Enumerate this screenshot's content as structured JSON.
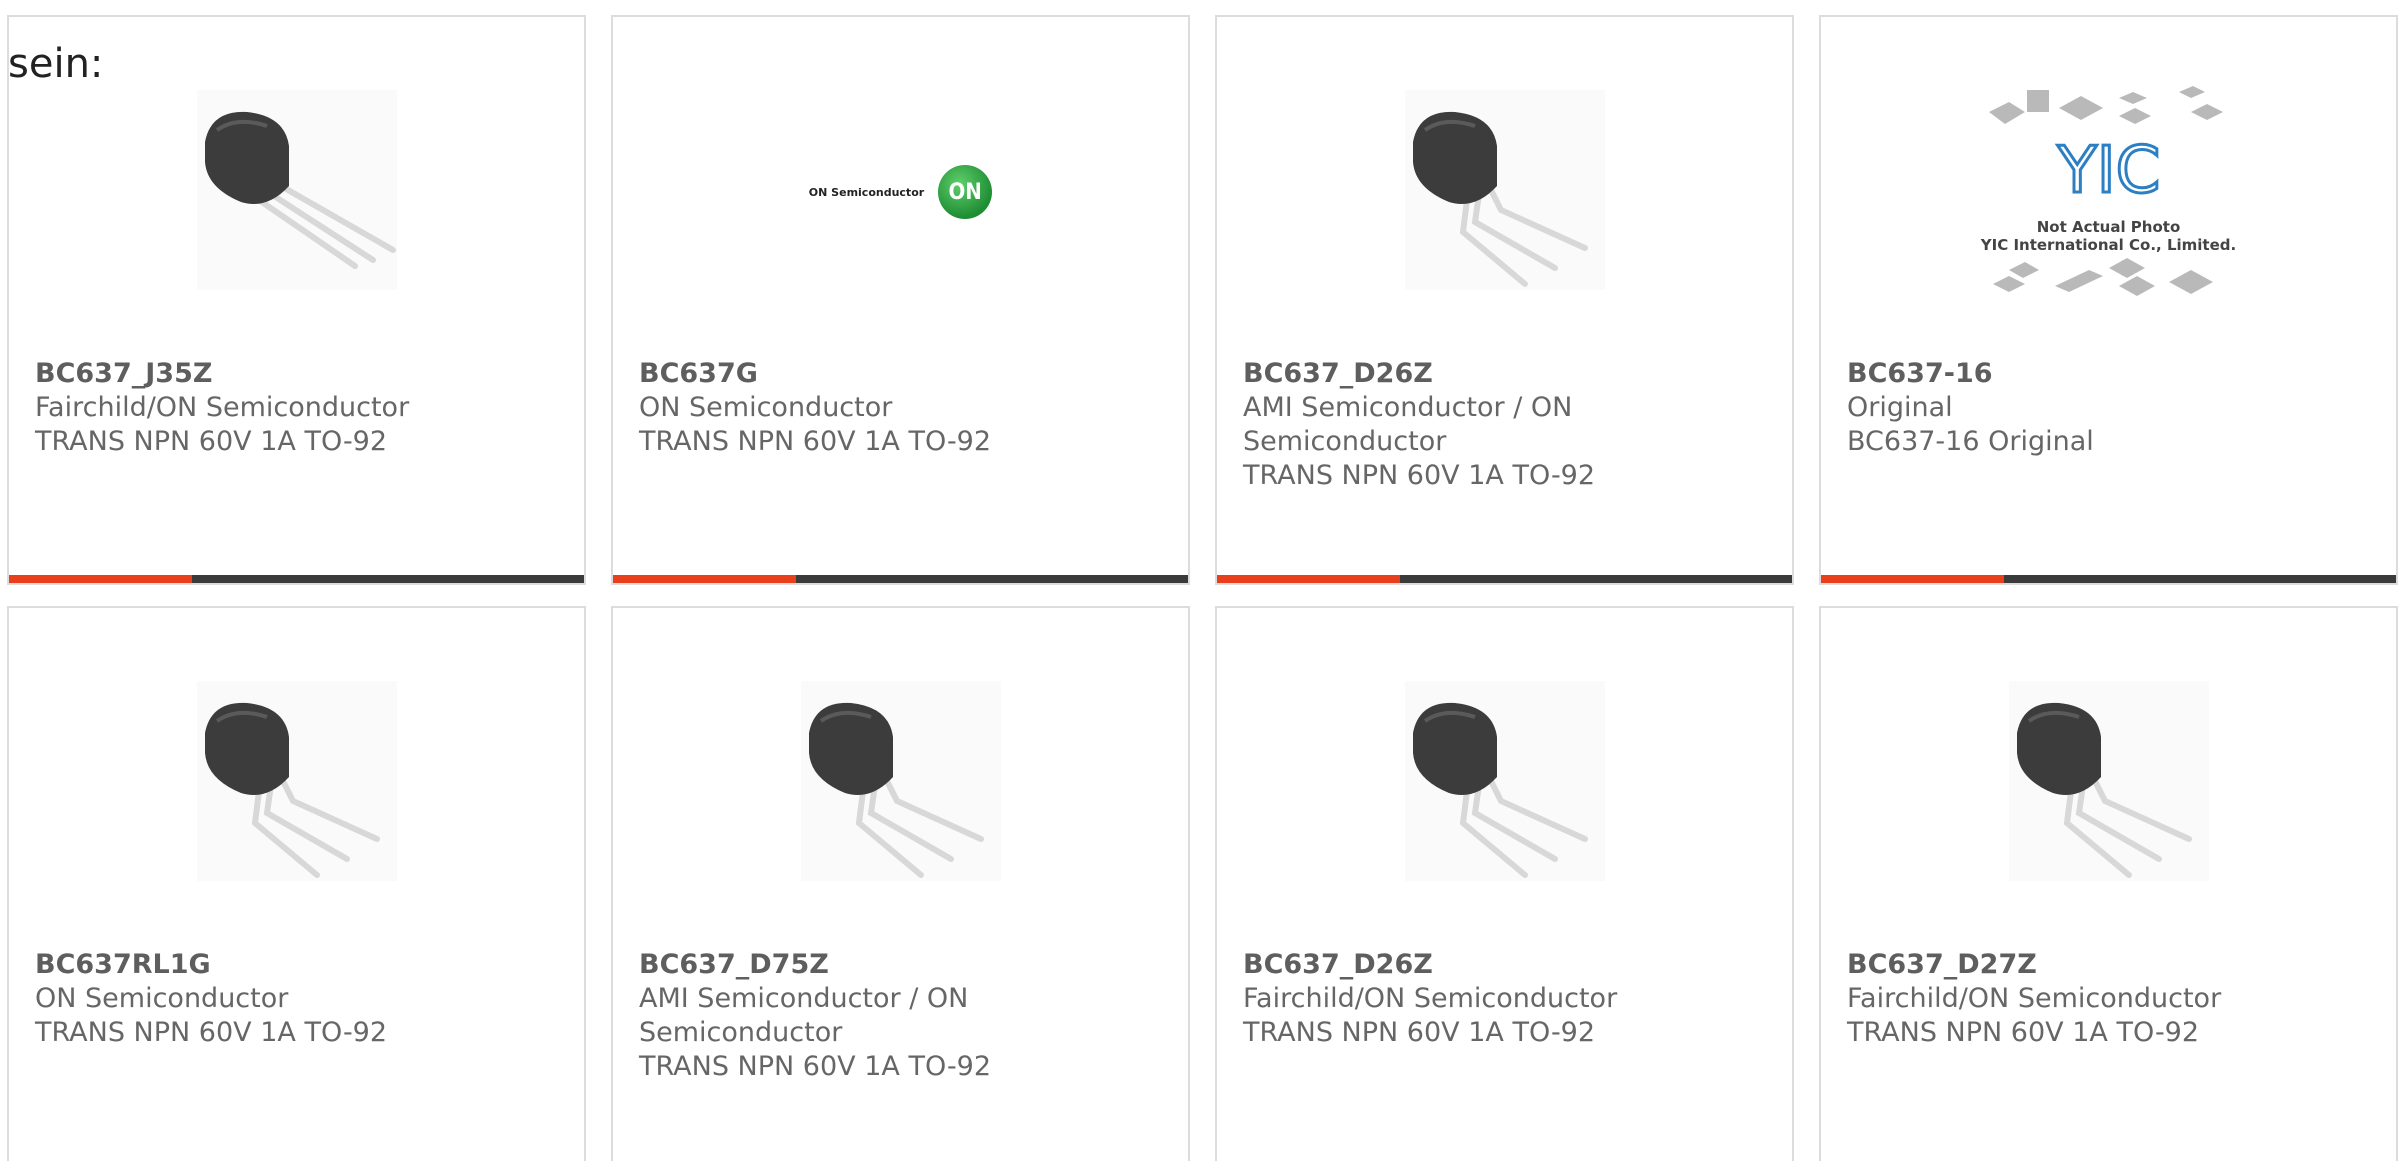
{
  "intro_text": "sein:",
  "colors": {
    "accent": "#e8401c",
    "bar": "#3a3a3a",
    "card_border": "#dcdcdc",
    "text": "#666666"
  },
  "logo": {
    "on_wordmark": "ON Semiconductor",
    "on_badge": "ON",
    "yic_mark": "YIC",
    "yic_caption_1": "Not Actual Photo",
    "yic_caption_2": "YIC International Co., Limited."
  },
  "products": [
    {
      "part": "BC637_J35Z",
      "maker": "Fairchild/ON Semiconductor",
      "maker2": "",
      "desc": "TRANS NPN 60V 1A TO-92",
      "image": "transistor-straight-legs",
      "show_bar": true
    },
    {
      "part": "BC637G",
      "maker": "ON Semiconductor",
      "maker2": "",
      "desc": "TRANS NPN 60V 1A TO-92",
      "image": "on-semiconductor-logo",
      "show_bar": true
    },
    {
      "part": "BC637_D26Z",
      "maker": "AMI Semiconductor / ON",
      "maker2": "Semiconductor",
      "desc": "TRANS NPN 60V 1A TO-92",
      "image": "transistor-bent-legs",
      "show_bar": true
    },
    {
      "part": "BC637-16",
      "maker": "Original",
      "maker2": "",
      "desc": "BC637-16 Original",
      "image": "yic-placeholder",
      "show_bar": true
    },
    {
      "part": "BC637RL1G",
      "maker": "ON Semiconductor",
      "maker2": "",
      "desc": "TRANS NPN 60V 1A TO-92",
      "image": "transistor-bent-legs",
      "show_bar": false
    },
    {
      "part": "BC637_D75Z",
      "maker": "AMI Semiconductor / ON",
      "maker2": "Semiconductor",
      "desc": "TRANS NPN 60V 1A TO-92",
      "image": "transistor-bent-legs",
      "show_bar": false
    },
    {
      "part": "BC637_D26Z",
      "maker": "Fairchild/ON Semiconductor",
      "maker2": "",
      "desc": "TRANS NPN 60V 1A TO-92",
      "image": "transistor-bent-legs",
      "show_bar": false
    },
    {
      "part": "BC637_D27Z",
      "maker": "Fairchild/ON Semiconductor",
      "maker2": "",
      "desc": "TRANS NPN 60V 1A TO-92",
      "image": "transistor-bent-legs",
      "show_bar": false
    }
  ]
}
